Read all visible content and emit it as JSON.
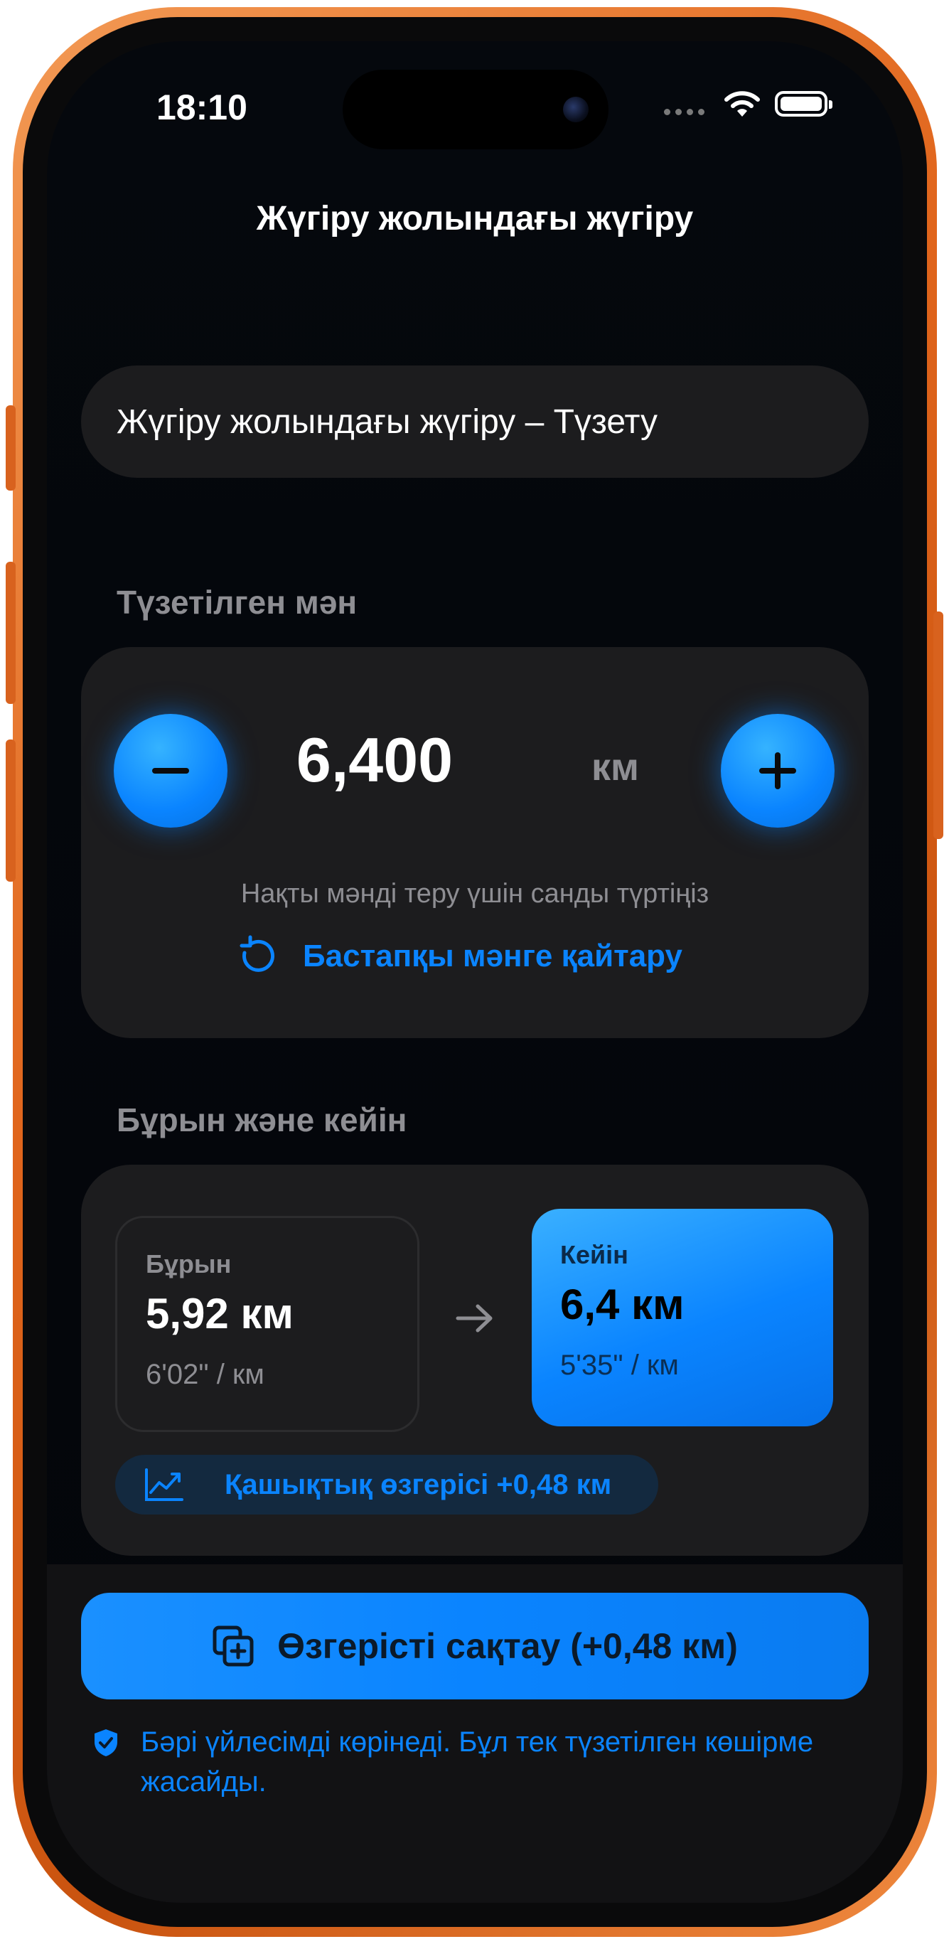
{
  "status_bar": {
    "time": "18:10"
  },
  "nav": {
    "title": "Жүгіру жолындағы жүгіру"
  },
  "name_field": {
    "value": "Жүгіру жолындағы жүгіру – Түзету"
  },
  "adjusted": {
    "section_title": "Түзетілген мән",
    "value": "6,400",
    "unit": "км",
    "hint": "Нақты мәнді теру үшін санды түртіңіз",
    "reset_label": "Бастапқы мәнге қайтару"
  },
  "comparison": {
    "section_title": "Бұрын және кейін",
    "before": {
      "label": "Бұрын",
      "value": "5,92 км",
      "pace": "6'02\" / км"
    },
    "after": {
      "label": "Кейін",
      "value": "6,4 км",
      "pace": "5'35\" / км"
    },
    "change_label": "Қашықтық өзгерісі +0,48 км"
  },
  "footer": {
    "save_label": "Өзгерісті сақтау (+0,48 км)",
    "note": "Бәрі үйлесімді көрінеді. Бұл тек түзетілген көшірме жасайды."
  },
  "colors": {
    "accent": "#0a84ff",
    "card": "#1c1c1e",
    "frame": "#e0651c"
  }
}
